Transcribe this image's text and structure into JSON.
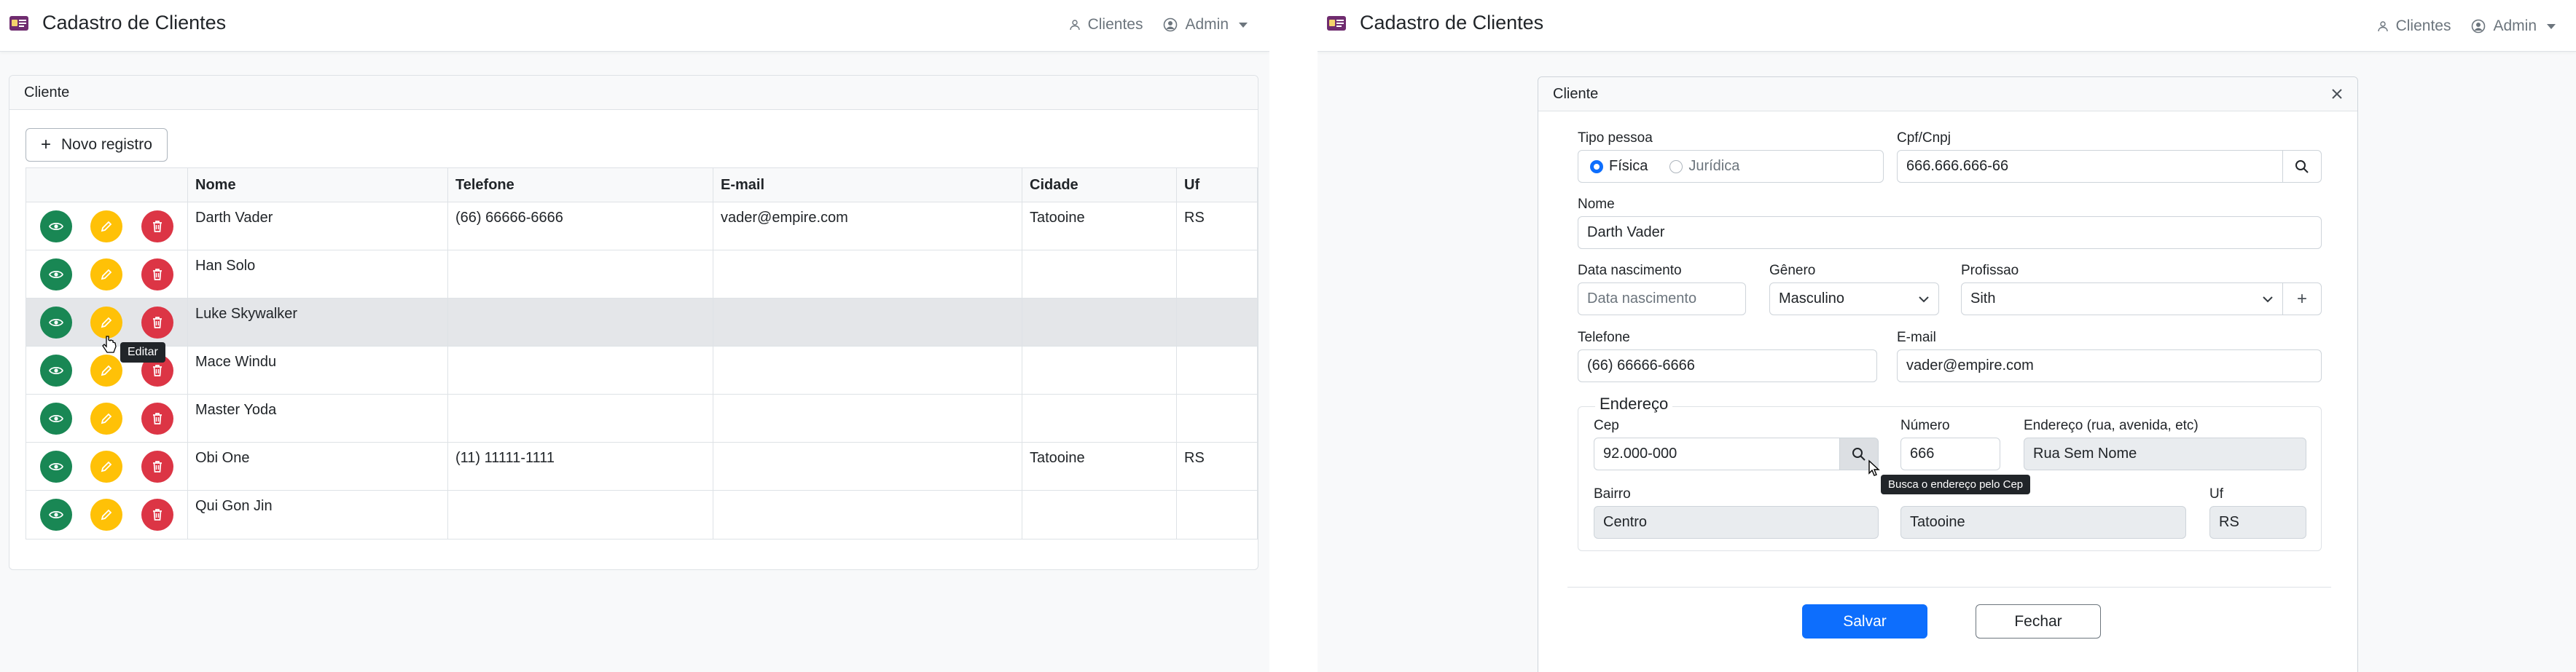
{
  "app": {
    "brand": "Cadastro de Clientes",
    "nav": {
      "clientes": "Clientes",
      "admin": "Admin"
    }
  },
  "list": {
    "card_title": "Cliente",
    "new_button": "Novo registro",
    "columns": [
      "Nome",
      "Telefone",
      "E-mail",
      "Cidade",
      "Uf"
    ],
    "rows": [
      {
        "nome": "Darth Vader",
        "telefone": "(66) 66666-6666",
        "email": "vader@empire.com",
        "cidade": "Tatooine",
        "uf": "RS"
      },
      {
        "nome": "Han Solo",
        "telefone": "",
        "email": "",
        "cidade": "",
        "uf": ""
      },
      {
        "nome": "Luke Skywalker",
        "telefone": "",
        "email": "",
        "cidade": "",
        "uf": ""
      },
      {
        "nome": "Mace Windu",
        "telefone": "",
        "email": "",
        "cidade": "",
        "uf": ""
      },
      {
        "nome": "Master Yoda",
        "telefone": "",
        "email": "",
        "cidade": "",
        "uf": ""
      },
      {
        "nome": "Obi One",
        "telefone": "(11) 11111-1111",
        "email": "",
        "cidade": "Tatooine",
        "uf": "RS"
      },
      {
        "nome": "Qui Gon Jin",
        "telefone": "",
        "email": "",
        "cidade": "",
        "uf": ""
      }
    ],
    "tooltip": "Editar"
  },
  "form": {
    "title": "Cliente",
    "tipo_pessoa": {
      "label": "Tipo pessoa",
      "option1": "Física",
      "option2": "Jurídica",
      "selected": "Física"
    },
    "cpf": {
      "label": "Cpf/Cnpj",
      "value": "666.666.666-66"
    },
    "nome": {
      "label": "Nome",
      "value": "Darth Vader"
    },
    "nascimento": {
      "label": "Data nascimento",
      "placeholder": "Data nascimento"
    },
    "genero": {
      "label": "Gênero",
      "value": "Masculino"
    },
    "profissao": {
      "label": "Profissao",
      "value": "Sith"
    },
    "telefone": {
      "label": "Telefone",
      "value": "(66) 66666-6666"
    },
    "email": {
      "label": "E-mail",
      "value": "vader@empire.com"
    },
    "endereco": {
      "legend": "Endereço",
      "cep": {
        "label": "Cep",
        "value": "92.000-000"
      },
      "numero": {
        "label": "Número",
        "value": "666"
      },
      "rua": {
        "label": "Endereço (rua, avenida, etc)",
        "value": "Rua Sem Nome"
      },
      "bairro": {
        "label": "Bairro",
        "value": "Centro"
      },
      "cidade": {
        "value": "Tatooine"
      },
      "uf": {
        "label": "Uf",
        "value": "RS"
      },
      "tooltip": "Busca o endereço pelo Cep"
    },
    "save": "Salvar",
    "close": "Fechar"
  },
  "colors": {
    "primary": "#0d6efd",
    "success": "#198754",
    "warning": "#ffc107",
    "danger": "#dc3545"
  }
}
